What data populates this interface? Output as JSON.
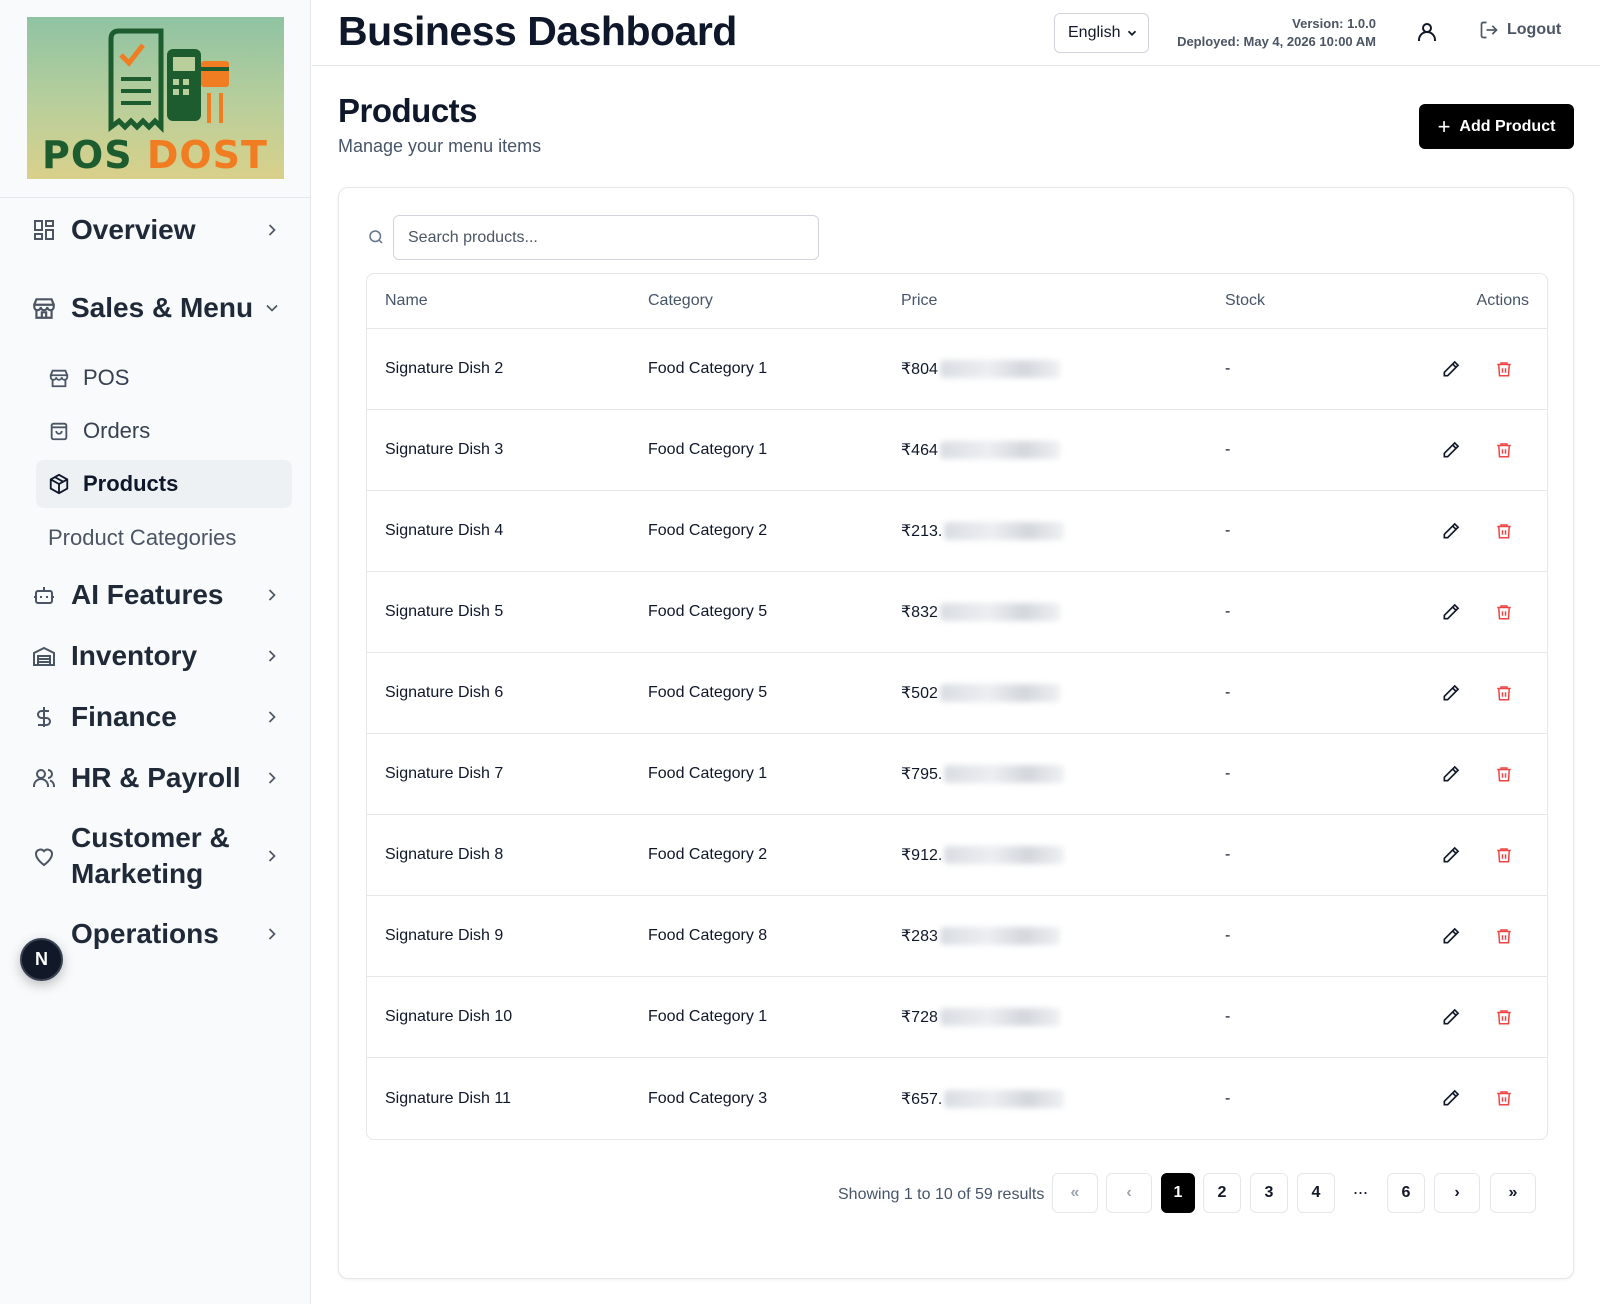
{
  "logo": {
    "text_pos": "POS",
    "text_dost": "DOST"
  },
  "sidebar": {
    "sections": [
      {
        "label": "Overview",
        "icon": "dashboard-grid-icon"
      },
      {
        "label": "Sales & Menu",
        "icon": "store-icon"
      },
      {
        "label": "AI Features",
        "icon": "robot-icon"
      },
      {
        "label": "Inventory",
        "icon": "warehouse-icon"
      },
      {
        "label": "Finance",
        "icon": "dollar-icon"
      },
      {
        "label": "HR & Payroll",
        "icon": "users-icon"
      },
      {
        "label": "Customer & Marketing",
        "icon": "heart-icon"
      },
      {
        "label": "Operations",
        "icon": "operations-icon"
      }
    ],
    "sales_sub": [
      {
        "label": "POS",
        "icon": "store-icon"
      },
      {
        "label": "Orders",
        "icon": "shopping-bag-icon"
      },
      {
        "label": "Products",
        "icon": "package-icon",
        "active": true
      },
      {
        "label": "Product Categories"
      }
    ],
    "badge_letter": "N"
  },
  "header": {
    "title": "Business Dashboard",
    "language": "English",
    "version": "Version: 1.0.0",
    "deployed": "Deployed: May 4, 2026 10:00 AM",
    "logout": "Logout"
  },
  "page": {
    "title": "Products",
    "subtitle": "Manage your menu items",
    "add_button": "Add Product"
  },
  "search": {
    "placeholder": "Search products..."
  },
  "table": {
    "headers": {
      "name": "Name",
      "category": "Category",
      "price": "Price",
      "stock": "Stock",
      "actions": "Actions"
    },
    "rows": [
      {
        "name": "Signature Dish 2",
        "category": "Food Category 1",
        "price": "₹804",
        "stock": "-"
      },
      {
        "name": "Signature Dish 3",
        "category": "Food Category 1",
        "price": "₹464",
        "stock": "-"
      },
      {
        "name": "Signature Dish 4",
        "category": "Food Category 2",
        "price": "₹213.",
        "stock": "-"
      },
      {
        "name": "Signature Dish 5",
        "category": "Food Category 5",
        "price": "₹832",
        "stock": "-"
      },
      {
        "name": "Signature Dish 6",
        "category": "Food Category 5",
        "price": "₹502",
        "stock": "-"
      },
      {
        "name": "Signature Dish 7",
        "category": "Food Category 1",
        "price": "₹795.",
        "stock": "-"
      },
      {
        "name": "Signature Dish 8",
        "category": "Food Category 2",
        "price": "₹912.",
        "stock": "-"
      },
      {
        "name": "Signature Dish 9",
        "category": "Food Category 8",
        "price": "₹283",
        "stock": "-"
      },
      {
        "name": "Signature Dish 10",
        "category": "Food Category 1",
        "price": "₹728",
        "stock": "-"
      },
      {
        "name": "Signature Dish 11",
        "category": "Food Category 3",
        "price": "₹657.",
        "stock": "-"
      }
    ]
  },
  "pagination": {
    "showing": "Showing 1 to 10 of 59 results",
    "first": "«",
    "prev": "‹",
    "pages": [
      "1",
      "2",
      "3",
      "4"
    ],
    "ellipsis": "...",
    "last_page": "6",
    "next": "›",
    "last": "»",
    "current": "1"
  },
  "colors": {
    "primary": "#000000",
    "danger": "#ef4444",
    "sidebar_bg": "#f8fafc",
    "active_bg": "#eef1f4"
  }
}
